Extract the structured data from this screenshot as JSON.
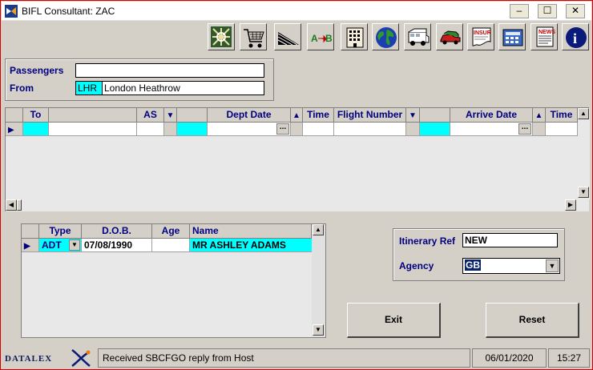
{
  "window": {
    "title": "BIFL Consultant: ZAC",
    "minimize": "–",
    "maximize": "☐",
    "close": "✕"
  },
  "toolbar": {
    "buttons": [
      "barcode-icon",
      "shopping-cart-icon",
      "ship-icon",
      "a-to-b-icon",
      "hotel-icon",
      "globe-icon",
      "campervan-icon",
      "car-icon",
      "insurance-icon",
      "calculator-icon",
      "news-icon",
      "info-icon"
    ],
    "insurance_text": "INSUR",
    "news_text": "NEWS",
    "a_text": "A",
    "b_text": "B",
    "info_text": "i"
  },
  "search": {
    "passengers_label": "Passengers",
    "from_label": "From",
    "passengers_value": "",
    "from_code": "LHR",
    "from_name": "London Heathrow"
  },
  "flights_grid": {
    "headers": [
      "To",
      "AS",
      "Dept Date",
      "Time",
      "Flight Number",
      "Arrive Date",
      "Time"
    ],
    "ellipsis": "..."
  },
  "passenger_grid": {
    "headers": [
      "Type",
      "D.O.B.",
      "Age",
      "Name"
    ],
    "rows": [
      {
        "type": "ADT",
        "dob": "07/08/1990",
        "age": "",
        "name": "MR ASHLEY ADAMS"
      }
    ]
  },
  "itinerary": {
    "ref_label": "Itinerary Ref",
    "ref_value": "NEW",
    "agency_label": "Agency",
    "agency_value": "GB"
  },
  "actions": {
    "exit_label": "Exit",
    "reset_label": "Reset"
  },
  "status": {
    "logo_text": "DATALEX",
    "message": "Received SBCFGO reply from Host",
    "date": "06/01/2020",
    "time": "15:27"
  }
}
